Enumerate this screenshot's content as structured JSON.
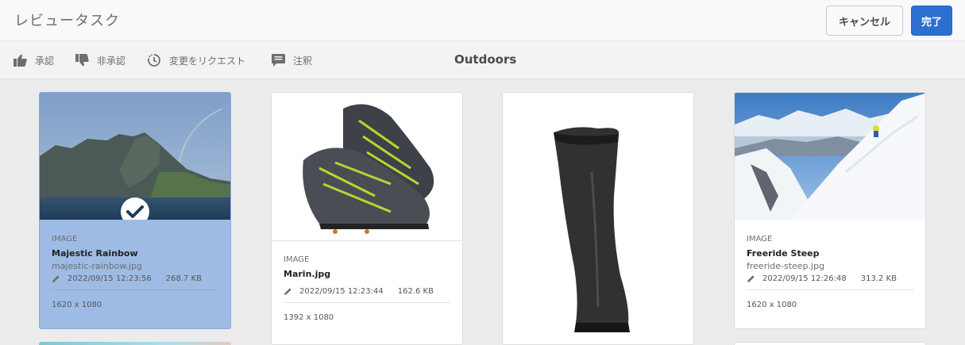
{
  "header": {
    "title": "レビュータスク",
    "cancel_label": "キャンセル",
    "done_label": "完了"
  },
  "actions": {
    "approve": "承認",
    "reject": "非承認",
    "request_changes": "変更をリクエスト",
    "annotate": "注釈"
  },
  "folder_title": "Outdoors",
  "cards": [
    {
      "type": "IMAGE",
      "title": "Majestic Rainbow",
      "filename": "majestic-rainbow.jpg",
      "modified": "2022/09/15 12:23:56",
      "size": "268.7 KB",
      "dimensions": "1620 x 1080",
      "selected": true
    },
    {
      "type": "IMAGE",
      "title": "Marin.jpg",
      "filename": "",
      "modified": "2022/09/15 12:23:44",
      "size": "162.6 KB",
      "dimensions": "1392 x 1080",
      "selected": false
    },
    {
      "type": "",
      "title": "",
      "filename": "",
      "modified": "",
      "size": "",
      "dimensions": "",
      "selected": false
    },
    {
      "type": "IMAGE",
      "title": "Freeride Steep",
      "filename": "freeride-steep.jpg",
      "modified": "2022/09/15 12:26:48",
      "size": "313.2 KB",
      "dimensions": "1620 x 1080",
      "selected": false
    }
  ],
  "colors": {
    "accent": "#2d6fd0",
    "selected_card": "#9ebbe4"
  }
}
